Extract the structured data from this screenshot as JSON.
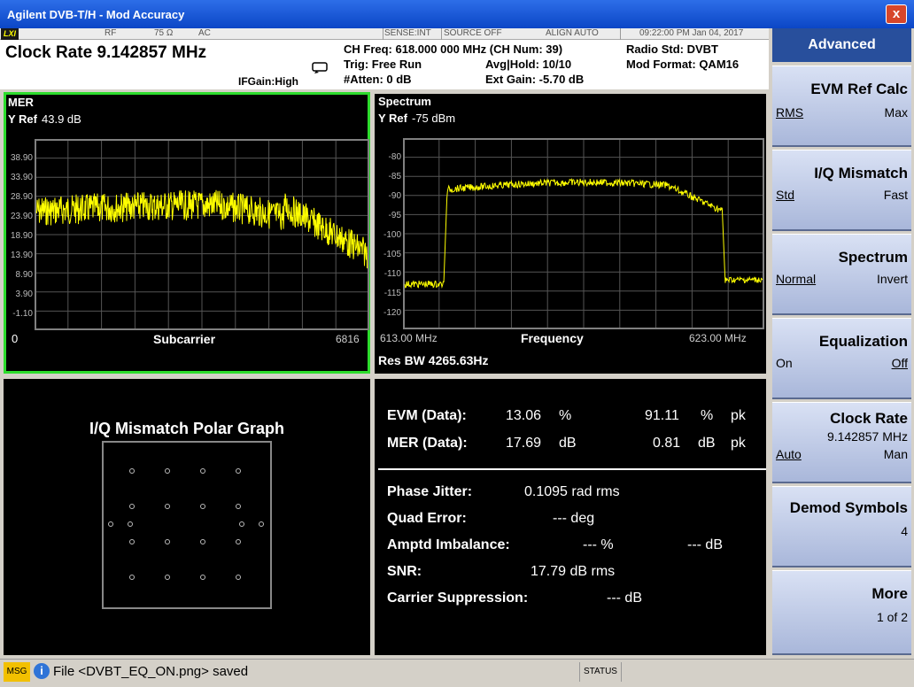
{
  "window": {
    "title": "Agilent DVB-T/H - Mod Accuracy",
    "close_label": "x"
  },
  "status_row": {
    "logo": "LXI",
    "rf": "RF",
    "impedance": "75 Ω",
    "coupling": "AC",
    "sense": "SENSE:INT",
    "source": "SOURCE OFF",
    "align": "ALIGN AUTO",
    "datetime": "09:22:00 PM Jan 04, 2017"
  },
  "info": {
    "clock_rate": "Clock Rate 9.142857 MHz",
    "if_gain": "IFGain:High",
    "ch_freq": "CH Freq: 618.000 000 MHz (CH Num: 39)",
    "trig": "Trig: Free Run",
    "avg_hold": "Avg|Hold: 10/10",
    "atten": "#Atten: 0 dB",
    "ext_gain": "Ext Gain: -5.70 dB",
    "radio_std": "Radio Std: DVBT",
    "mod_format": "Mod Format: QAM16"
  },
  "mer": {
    "title": "MER",
    "yref_label": "Y Ref",
    "yref_value": "43.9 dB",
    "yticks": [
      "38.90",
      "33.90",
      "28.90",
      "23.90",
      "18.90",
      "13.90",
      "8.90",
      "3.90",
      "-1.10"
    ],
    "x_start": "0",
    "x_label": "Subcarrier",
    "x_end": "6816"
  },
  "spectrum": {
    "title": "Spectrum",
    "yref_label": "Y Ref",
    "yref_value": "-75 dBm",
    "yticks": [
      "-80",
      "-85",
      "-90",
      "-95",
      "-100",
      "-105",
      "-110",
      "-115",
      "-120"
    ],
    "x_start": "613.00 MHz",
    "x_label": "Frequency",
    "x_end": "623.00 MHz",
    "res_bw": "Res BW 4265.63Hz"
  },
  "iq": {
    "title": "I/Q Mismatch Polar Graph"
  },
  "results": {
    "evm_label": "EVM (Data):",
    "evm_value": "13.06",
    "evm_unit": "%",
    "evm_pk": "91.11",
    "evm_pk_unit": "%",
    "evm_pk_suffix": "pk",
    "mer_label": "MER (Data):",
    "mer_value": "17.69",
    "mer_unit": "dB",
    "mer_pk": "0.81",
    "mer_pk_unit": "dB",
    "mer_pk_suffix": "pk",
    "phase_label": "Phase Jitter:",
    "phase_value": "0.1095 rad rms",
    "quad_label": "Quad Error:",
    "quad_value": "--- deg",
    "amptd_label": "Amptd Imbalance:",
    "amptd_value1": "--- %",
    "amptd_value2": "--- dB",
    "snr_label": "SNR:",
    "snr_value": "17.79 dB rms",
    "carrier_label": "Carrier Suppression:",
    "carrier_value": "--- dB"
  },
  "softkeys": {
    "header": "Advanced",
    "evm": {
      "label": "EVM Ref Calc",
      "opt1": "RMS",
      "opt2": "Max"
    },
    "iqm": {
      "label": "I/Q Mismatch",
      "opt1": "Std",
      "opt2": "Fast"
    },
    "spec": {
      "label": "Spectrum",
      "opt1": "Normal",
      "opt2": "Invert"
    },
    "eq": {
      "label": "Equalization",
      "opt1": "On",
      "opt2": "Off"
    },
    "clk": {
      "label": "Clock Rate",
      "value": "9.142857 MHz",
      "opt1": "Auto",
      "opt2": "Man"
    },
    "demod": {
      "label": "Demod Symbols",
      "value": "4"
    },
    "more": {
      "label": "More",
      "value": "1 of 2"
    }
  },
  "message": {
    "tag": "MSG",
    "info_icon": "i",
    "text": "File <DVBT_EQ_ON.png> saved",
    "status": "STATUS"
  },
  "colors": {
    "trace": "#ffff00",
    "active_border": "#2ddc2d",
    "grid": "#606060"
  }
}
